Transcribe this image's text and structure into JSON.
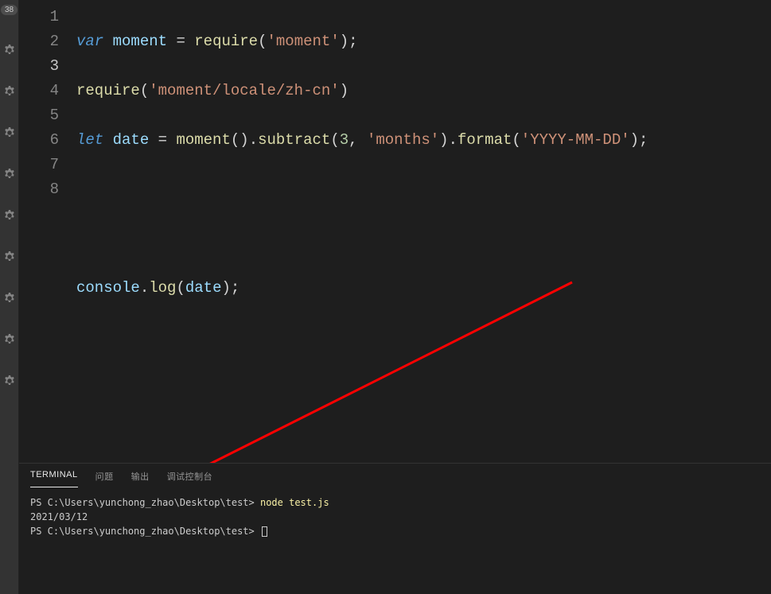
{
  "activityBar": {
    "badge": "38"
  },
  "editor": {
    "lineNumbers": [
      "1",
      "2",
      "3",
      "4",
      "5",
      "6",
      "7",
      "8"
    ],
    "line1": {
      "kw": "var",
      "sp1": " ",
      "ident": "moment",
      "sp2": " ",
      "eq": "=",
      "sp3": " ",
      "fn": "require",
      "lp": "(",
      "str": "'moment'",
      "rp": ")",
      "semi": ";"
    },
    "line2": {
      "fn": "require",
      "lp": "(",
      "str": "'moment/locale/zh-cn'",
      "rp": ")"
    },
    "line3": {
      "kw": "let",
      "sp1": " ",
      "ident": "date",
      "sp2": " ",
      "eq": "=",
      "sp3": " ",
      "fn1": "moment",
      "lp1": "(",
      "rp1": ")",
      "dot1": ".",
      "fn2": "subtract",
      "lp2": "(",
      "num": "3",
      "comma": ",",
      "sp4": " ",
      "str1": "'months'",
      "rp2": ")",
      "dot2": ".",
      "fn3": "format",
      "lp3": "(",
      "str2": "'YYYY-MM-DD'",
      "rp3": ")",
      "semi": ";"
    },
    "line6": {
      "obj": "console",
      "dot": ".",
      "fn": "log",
      "lp": "(",
      "arg": "date",
      "rp": ")",
      "semi": ";"
    }
  },
  "panel": {
    "tabs": {
      "terminal": "TERMINAL",
      "problems": "问题",
      "output": "输出",
      "debugConsole": "调试控制台"
    }
  },
  "terminal": {
    "line1_prompt": "PS C:\\Users\\yunchong_zhao\\Desktop\\test> ",
    "line1_cmd": "node test.js",
    "line2": "2021/03/12",
    "line3_prompt": "PS C:\\Users\\yunchong_zhao\\Desktop\\test> "
  }
}
